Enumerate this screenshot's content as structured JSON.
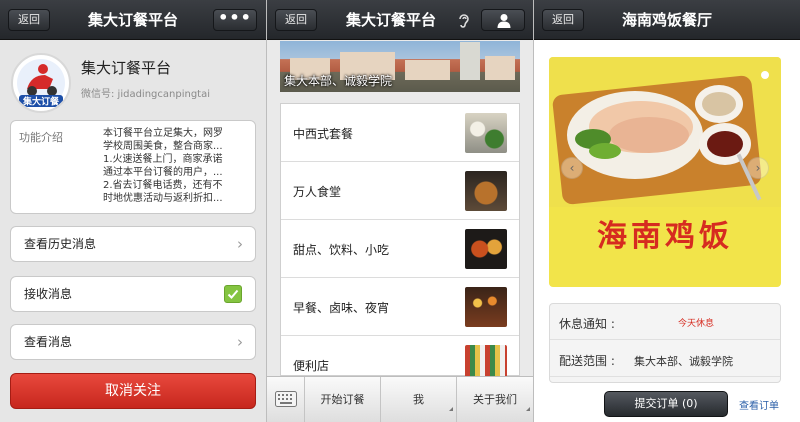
{
  "screen1": {
    "back_label": "返回",
    "title": "集大订餐平台",
    "more_label": "•••",
    "profile": {
      "avatar_text": "集大订餐",
      "name": "集大订餐平台",
      "wechat_id": "微信号: jidadingcanpingtai"
    },
    "intro": {
      "label": "功能介绍",
      "lines": [
        "本订餐平台立足集大，网罗",
        "学校周围美食，整合商家...",
        "1.火速送餐上门，商家承诺",
        "通过本平台订餐的用户，...",
        "2.省去订餐电话费，还有不",
        "时地优惠活动与返利折扣..."
      ]
    },
    "history_label": "查看历史消息",
    "receive_label": "接收消息",
    "receive_checked": true,
    "view_label": "查看消息",
    "unfollow_label": "取消关注"
  },
  "screen2": {
    "back_label": "返回",
    "title": "集大订餐平台",
    "banner_text": "集大本部、诚毅学院",
    "menu": [
      {
        "label": "中西式套餐"
      },
      {
        "label": "万人食堂"
      },
      {
        "label": "甜点、饮料、小吃"
      },
      {
        "label": "早餐、卤味、夜宵"
      },
      {
        "label": "便利店"
      }
    ],
    "tabs": [
      {
        "label": "开始订餐"
      },
      {
        "label": "我"
      },
      {
        "label": "关于我们"
      }
    ]
  },
  "screen3": {
    "back_label": "返回",
    "title": "海南鸡饭餐厅",
    "photo_caption": "海南鸡饭",
    "rest_label": "休息通知 :",
    "rest_value": "今天休息",
    "delivery_label": "配送范围 :",
    "delivery_value": "集大本部、诚毅学院",
    "submit_label": "提交订单 (0)",
    "view_order_label": "查看订单"
  },
  "colors": {
    "topbar": "#2d3035",
    "unfollow": "#d9372c",
    "checkbox": "#84c441",
    "rest_red": "#d62b20",
    "link_blue": "#2b5fa8",
    "photo_yellow": "#f2e44a"
  }
}
